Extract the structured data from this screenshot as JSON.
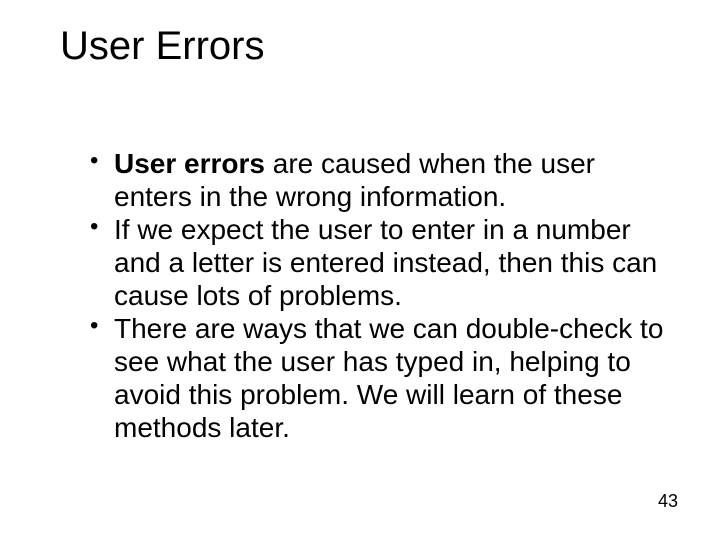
{
  "title": "User Errors",
  "bullets": [
    {
      "bold": "User errors",
      "rest": " are caused when the user enters in the wrong information."
    },
    {
      "bold": "",
      "rest": "If we expect the user to enter in a number and a letter is entered instead, then this can cause lots of problems."
    },
    {
      "bold": "",
      "rest": "There are ways that we can double-check to see what the user has typed in, helping to avoid this problem. We will learn of these methods later."
    }
  ],
  "page_number": "43"
}
